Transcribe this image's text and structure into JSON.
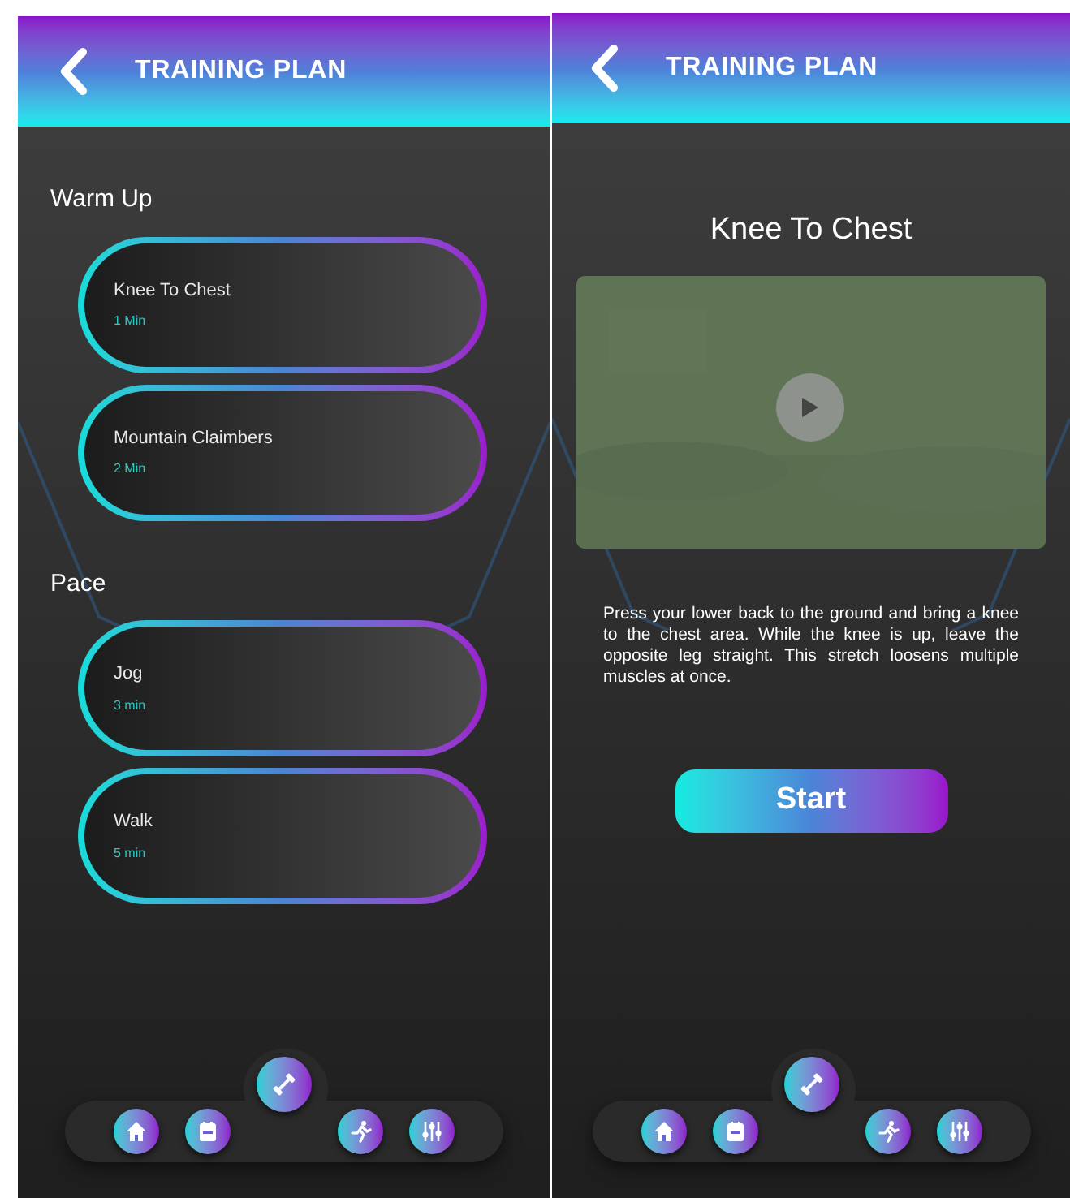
{
  "screens": [
    {
      "kind": "list",
      "header": {
        "title": "TRAINING PLAN"
      },
      "sections": [
        {
          "title": "Warm Up",
          "exercises": [
            {
              "name": "Knee To Chest",
              "duration": "1 Min"
            },
            {
              "name": "Mountain Claimbers",
              "duration": "2 Min"
            }
          ]
        },
        {
          "title": "Pace",
          "exercises": [
            {
              "name": "Jog",
              "duration": "3 min"
            },
            {
              "name": "Walk",
              "duration": "5 min"
            }
          ]
        }
      ],
      "nav": [
        {
          "kind": "home",
          "selected": false
        },
        {
          "kind": "calendar",
          "selected": false
        },
        {
          "kind": "dumbbell",
          "selected": true
        },
        {
          "kind": "runner",
          "selected": false
        },
        {
          "kind": "sliders",
          "selected": false
        }
      ]
    },
    {
      "kind": "detail",
      "header": {
        "title": "TRAINING PLAN"
      },
      "exercise_title": "Knee To Chest",
      "description": "Press your lower back to the ground and bring a knee to the chest area. While the knee is up, leave the opposite leg straight. This stretch loosens multiple muscles at once.",
      "start_button": "Start",
      "nav": [
        {
          "kind": "home",
          "selected": false
        },
        {
          "kind": "calendar",
          "selected": false
        },
        {
          "kind": "dumbbell",
          "selected": true
        },
        {
          "kind": "runner",
          "selected": false
        },
        {
          "kind": "sliders",
          "selected": false
        }
      ]
    }
  ]
}
